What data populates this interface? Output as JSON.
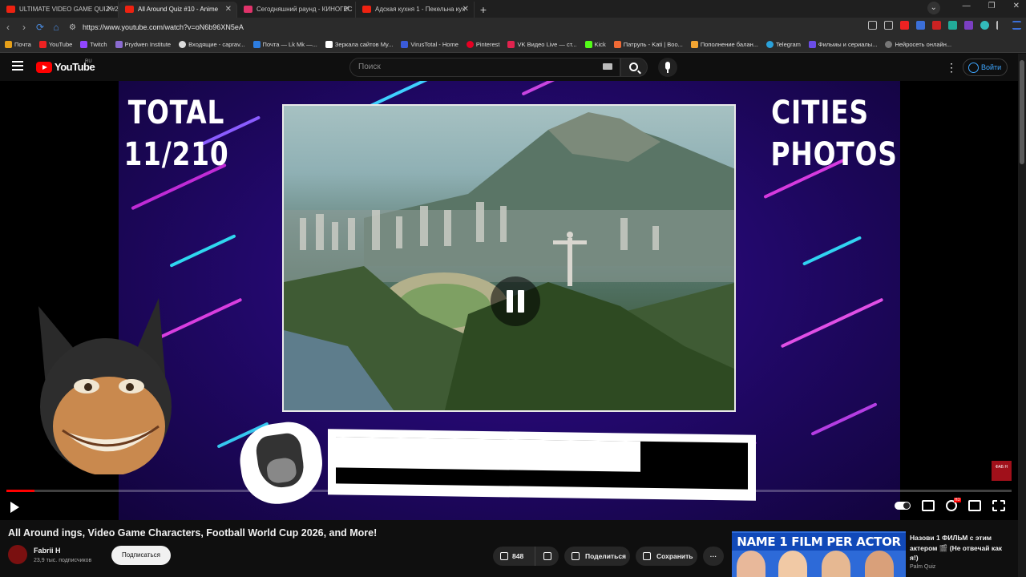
{
  "browser": {
    "tabs": [
      {
        "label": "ULTIMATE VIDEO GAME QUIZ #2",
        "active": false
      },
      {
        "label": "All Around Quiz #10 - Anime",
        "active": true
      },
      {
        "label": "Сегодняшний раунд - КИНОГЕС",
        "active": false
      },
      {
        "label": "Адская кухня 1 - Пекельна кух",
        "active": false
      }
    ],
    "url": "https://www.youtube.com/watch?v=oN6b96XN5eA",
    "bookmarks": [
      "Почта",
      "YouTube",
      "Twitch",
      "Prydwen Institute",
      "Входящие - caprav...",
      "Почта — Lk Mk —...",
      "Зеркала сайтов My...",
      "VirusTotal - Home",
      "Pinterest",
      "VK Видео Live — ст...",
      "Kick",
      "Патруль - Kati | Boo...",
      "Пополнение балан...",
      "Telegram",
      "Фильмы и сериалы...",
      "Нейросеть онлайн..."
    ]
  },
  "header": {
    "logo_text": "YouTube",
    "region": "RU",
    "search_placeholder": "Поиск",
    "signin_label": "Войти"
  },
  "video": {
    "left_text_line1": "TOTAL",
    "left_text_line2": "11/210",
    "right_text_line1": "CITIES",
    "right_text_line2": "PHOTOS",
    "timer_fraction": 0.77,
    "progress_fraction": 0.028,
    "watermark_text": "ФАБ Н",
    "accent_color": "#ff0000"
  },
  "info": {
    "title": "All Around Quiz #10 - Anime Openings, Video Game Characters, Football World Cup 2026, and More!",
    "title_visible": "All Around                          ings, Video Game Characters, Football World Cup 2026, and More!",
    "channel_name": "Fabrii H",
    "subscribers": "23,9 тыс. подписчиков",
    "subscribe_label": "Подписаться",
    "likes": "848",
    "share_label": "Поделиться",
    "save_label": "Сохранить",
    "more_label": "···"
  },
  "recommendation": {
    "thumb_text": "NAME 1 FILM PER ACTOR",
    "title": "Назови 1 ФИЛЬМ с этим актером 🎬 (Не отвечай как я!)",
    "channel": "Palm Quiz"
  }
}
